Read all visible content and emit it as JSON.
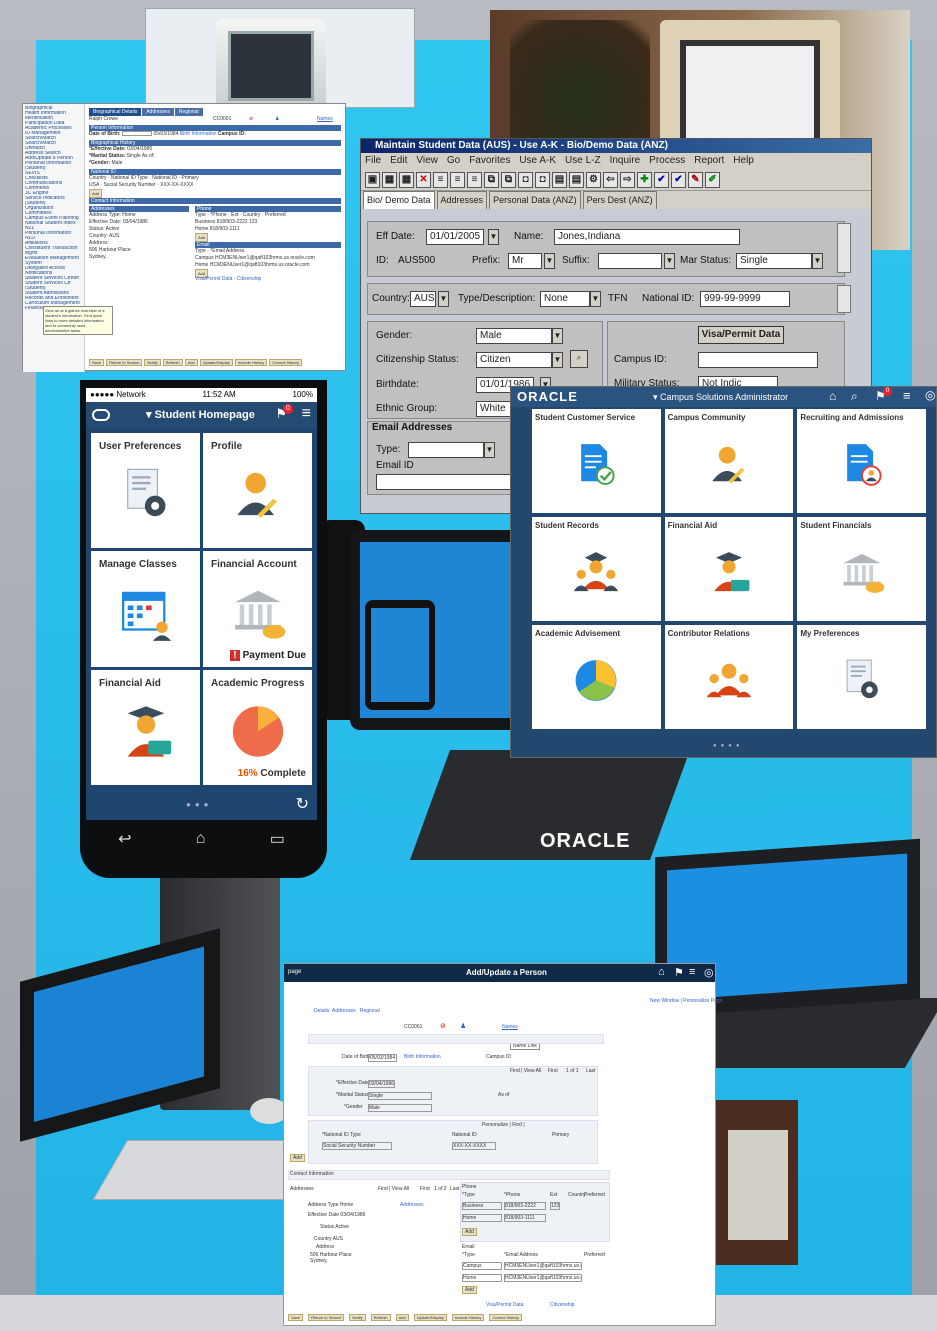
{
  "ps1": {
    "nav_items": [
      "Biographical",
      "Health Information",
      "Identification",
      "Participation Data",
      "Academic Processes",
      "ID Management",
      "Search/Match",
      "Search/Match",
      "Unmatch",
      "Address Search",
      "Add/Update a Person",
      "Personal Information",
      "(Student)",
      "SEVIS",
      "Checklists",
      "Communications",
      "Comments",
      "3C Engine",
      "Service Indicators",
      "(Student)",
      "Organization",
      "Committees",
      "Campus Event Planning",
      "National Student Index",
      "NZL",
      "Personal Information",
      "NLD",
      "Affiliations",
      "Constituent Transaction",
      "Mgmt",
      "Evaluation Management",
      "System",
      "Delegated Access",
      "Notifications",
      "Student Services Center",
      "Student Services Ctr",
      "(Student)",
      "Student Admissions",
      "Records and Enrollment",
      "Curriculum Management",
      "Financial Aid"
    ],
    "tabs": [
      "Biographical Details",
      "Addresses",
      "Regional"
    ],
    "name": "Ralph Crowe",
    "id": "CC0001",
    "names_link": "Names",
    "person_info": "Person Information",
    "dob_label": "Date of Birth:",
    "dob": "05/03/1984",
    "birth_info": "Birth Information",
    "campus_id": "Campus ID:",
    "bio_history": "Biographical History",
    "eff_date_label": "*Effective Date:",
    "eff_date": "03/04/1986",
    "marital_label": "*Marital Status:",
    "marital": "Single",
    "as_of": "As of:",
    "gender_label": "*Gender:",
    "gender": "Male",
    "national_id": "National ID",
    "country": "Country",
    "nid_type": "National ID Type",
    "nid": "National ID",
    "primary": "Primary",
    "usa": "USA",
    "ssn": "Social Security Number",
    "nid_val": "XXX-XX-XXXX",
    "add": "Add",
    "contact_info": "Contact Information",
    "addresses": "Addresses",
    "address_type": "Address Type: Home",
    "eff_date2": "Effective Date: 03/04/1986",
    "status": "Status: Active",
    "country2": "Country: AUS",
    "address": "Address:",
    "address1": "506 Harbour Place",
    "address2": "Sydney,",
    "phone": "Phone",
    "ph_type": "Type",
    "ph_phone": "*Phone",
    "ph_ext": "Ext",
    "ph_country": "Country",
    "ph_pref": "Preferred",
    "ph1": "Business",
    "ph1v": "818/903-2222",
    "ph1ext": "123",
    "ph2": "Home",
    "ph2v": "818/903-1111",
    "email": "Email",
    "em_addr": "*Email Address",
    "em1": "Campus",
    "em1v": "HCM3ENUser1@qaft103hrms.us.oracle.com",
    "em2": "Home",
    "em2v": "HCM3ENUser1@qaft103hrms.us.oracle.com",
    "visa": "Visa/Permit Data",
    "citizenship": "Citizenship",
    "tooltip": "View an at a glance overview of a student's information. Find quick links to more detailed information and to commonly used administrative tasks.",
    "footer": [
      "Save",
      "Return to Search",
      "Notify",
      "Refresh",
      "Add",
      "Update/Display",
      "Include History",
      "Correct History"
    ]
  },
  "msd": {
    "title": "Maintain Student Data (AUS) - Use A-K - Bio/Demo Data (ANZ)",
    "menu": [
      "File",
      "Edit",
      "View",
      "Go",
      "Favorites",
      "Use A-K",
      "Use L-Z",
      "Inquire",
      "Process",
      "Report",
      "Help"
    ],
    "tabs": [
      "Bio/ Demo Data",
      "Addresses",
      "Personal Data (ANZ)",
      "Pers Dest (ANZ)"
    ],
    "eff_date_label": "Eff Date:",
    "eff_date": "01/01/2005",
    "name_label": "Name:",
    "name": "Jones,Indiana",
    "id_label": "ID:",
    "id": "AUS500",
    "prefix_label": "Prefix:",
    "prefix": "Mr",
    "suffix_label": "Suffix:",
    "mar_status_label": "Mar Status:",
    "mar_status": "Single",
    "country_label": "Country:",
    "country": "AUS",
    "type_label": "Type/Description:",
    "type": "None",
    "tfn": "TFN",
    "natid_label": "National ID:",
    "natid": "999-99-9999",
    "gender_label": "Gender:",
    "gender": "Male",
    "citizen_label": "Citizenship Status:",
    "citizen": "Citizen",
    "birthdate_label": "Birthdate:",
    "birthdate": "01/01/1986",
    "ethnic_label": "Ethnic Group:",
    "ethnic": "White",
    "visa_button": "Visa/Permit Data",
    "campus_id_label": "Campus ID:",
    "military_label": "Military Status:",
    "military": "Not Indic",
    "email_section": "Email Addresses",
    "email_type": "Type:",
    "email_id": "Email ID"
  },
  "phone": {
    "carrier": "●●●●● Network",
    "time": "11:52 AM",
    "battery": "100%",
    "title": "Student Homepage",
    "badge": "0",
    "tiles": [
      {
        "title": "User Preferences",
        "icon": "preferences-icon"
      },
      {
        "title": "Profile",
        "icon": "profile-icon"
      },
      {
        "title": "Manage Classes",
        "icon": "calendar-icon"
      },
      {
        "title": "Financial Account",
        "icon": "bank-icon",
        "note": "Payment Due"
      },
      {
        "title": "Financial Aid",
        "icon": "graduate-icon"
      },
      {
        "title": "Academic Progress",
        "icon": "pie-icon",
        "pct": "16%",
        "pct_label": " Complete"
      }
    ]
  },
  "fluid": {
    "logo": "ORACLE",
    "role": "Campus Solutions Administrator",
    "badge": "0",
    "tiles": [
      {
        "title": "Student Customer Service",
        "icon": "document-check-icon"
      },
      {
        "title": "Campus Community",
        "icon": "person-pencil-icon"
      },
      {
        "title": "Recruiting and Admissions",
        "icon": "document-person-icon"
      },
      {
        "title": "Student Records",
        "icon": "graduate-group-icon"
      },
      {
        "title": "Financial Aid",
        "icon": "graduate-card-icon"
      },
      {
        "title": "Student Financials",
        "icon": "bank-icon"
      },
      {
        "title": "Academic Advisement",
        "icon": "pie-icon"
      },
      {
        "title": "Contributor Relations",
        "icon": "people-icon"
      },
      {
        "title": "My Preferences",
        "icon": "preferences-icon"
      }
    ]
  },
  "aup": {
    "title": "Add/Update a Person",
    "home_prefix": "page",
    "links": "New Window | Personalize Page",
    "tabs": [
      "Details",
      "Addresses",
      "Regional"
    ],
    "id": "CC0001",
    "names_link": "Names",
    "tooltip": "Name Link",
    "dob_label": "Date of Birth",
    "dob": "05/03/1984",
    "birth_info": "Birth Information",
    "campus_id": "Campus ID",
    "find": "Find | View All",
    "first": "First",
    "of": "1 of 1",
    "last": "Last",
    "eff_label": "*Effective Date",
    "eff": "03/04/1986",
    "marital_label": "*Marital Status",
    "marital": "Single",
    "as_of": "As of",
    "gender_label": "*Gender",
    "gender": "Male",
    "personalize": "Personalize | Find |",
    "nid_type": "*National ID Type",
    "nid": "National ID",
    "primary": "Primary",
    "ssn": "Social Security Number",
    "nid_val": "XXX-XX-XXXX",
    "add": "Add",
    "contact": "Contact Information",
    "addresses": "Addresses",
    "find2": "Find | View All",
    "first2": "First",
    "of2": "1 of 2",
    "last2": "Last",
    "addr_type": "Address Type Home",
    "eff_date": "Effective Date 03/04/1986",
    "status": "Status Active",
    "country": "Country AUS",
    "address": "Address",
    "addr1": "506 Harbour Place",
    "addr2": "Sydney,",
    "addresses_link": "Addresses",
    "phone": "Phone",
    "ph_type": "*Type",
    "ph_phone": "*Phone",
    "ph_ext": "Ext",
    "ph_country": "Country",
    "ph_pref": "Preferred",
    "ph1": "Business",
    "ph1v": "818/903-2222",
    "ph1ext": "123",
    "ph2": "Home",
    "ph2v": "818/903-1111",
    "email": "Email",
    "em_type": "*Type",
    "em_addr": "*Email Address",
    "em_pref": "Preferred",
    "em1": "Campus",
    "em1v": "HCM3ENUser1@qaft103hrms.us.oracle.com",
    "em2": "Home",
    "em2v": "HCM3ENUser1@qaft103hrms.us.oracle.com",
    "visa": "Visa/Permit Data",
    "citizenship": "Citizenship",
    "footer": [
      "Save",
      "Return to Search",
      "Notify",
      "Refresh",
      "Add",
      "Update/Display",
      "Include History",
      "Correct History"
    ]
  },
  "laptop_logo": "ORACLE"
}
